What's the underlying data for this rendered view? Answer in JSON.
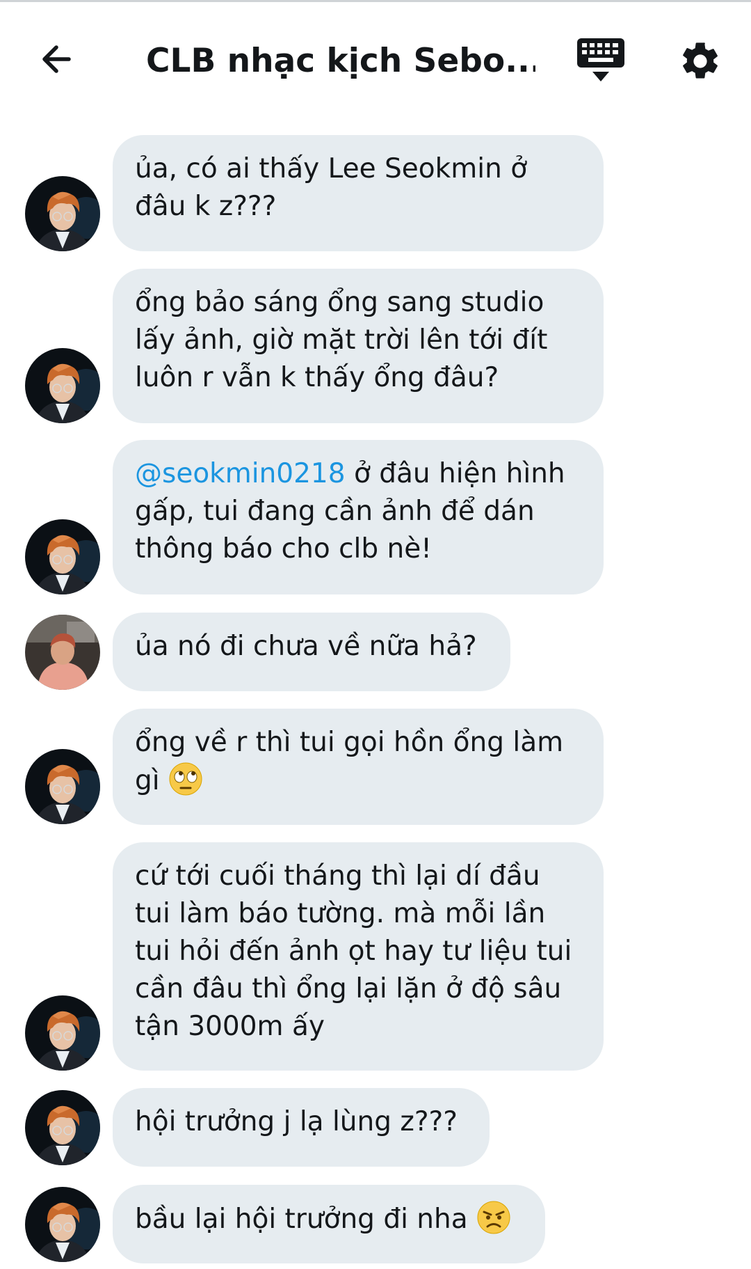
{
  "header": {
    "title": "CLB nhạc kịch Sebo...",
    "back_icon": "arrow-left-icon",
    "keyboard_icon": "keyboard-icon",
    "settings_icon": "gear-icon"
  },
  "colors": {
    "bubble_bg": "#e6ecf0",
    "mention": "#1b95e0",
    "text": "#14171a"
  },
  "messages": [
    {
      "avatar": "avatar-orange-hair",
      "text": "ủa, có ai thấy Lee Seokmin ở\nđâu k z???"
    },
    {
      "avatar": "avatar-orange-hair",
      "text": "ổng bảo sáng ổng sang studio\nlấy ảnh, giờ mặt trời lên tới đít\nluôn r vẫn k thấy ổng đâu?"
    },
    {
      "avatar": "avatar-orange-hair",
      "mention": "@seokmin0218",
      "text": " ở đâu hiện hình\ngấp, tui đang cần ảnh để dán\nthông báo cho clb nè!"
    },
    {
      "avatar": "avatar-pink-shirt",
      "text": "ủa nó đi chưa về nữa hả?"
    },
    {
      "avatar": "avatar-orange-hair",
      "text": "ổng về r thì tui gọi hồn ổng làm\ngì ",
      "emoji": "eye-roll-emoji"
    },
    {
      "avatar": "avatar-orange-hair",
      "text": "cứ tới cuối tháng thì lại dí đầu\ntui làm báo tường. mà mỗi lần\ntui hỏi đến ảnh ọt hay tư liệu tui\ncần đâu thì ổng lại lặn ở độ sâu\ntận 3000m ấy"
    },
    {
      "avatar": "avatar-orange-hair",
      "text": "hội trưởng j lạ lùng z???"
    },
    {
      "avatar": "avatar-orange-hair",
      "text": "bầu lại hội trưởng đi nha ",
      "emoji": "angry-emoji"
    }
  ]
}
